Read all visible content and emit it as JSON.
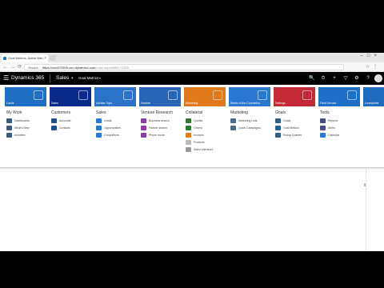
{
  "browser": {
    "tab_title": "Goal Metrics: Active Met...",
    "tab_close": "×",
    "window_controls": "–□×",
    "nav_glyphs": "←→⟳",
    "secure_label": "Secure",
    "url_host": "https://crm572905.crm.dynamics.com",
    "url_path": "/main.aspx#585172305",
    "right_icons": "☆⋮"
  },
  "navbar": {
    "waffle_glyph": "☰",
    "brand": "Dynamics 365",
    "module": "Sales",
    "module_chevron": "▾",
    "breadcrumb": "Goal Metrics",
    "breadcrumb_chevron": "▾",
    "icons": [
      "🔍",
      "⏱",
      "+",
      "▽",
      "⚙",
      "?"
    ]
  },
  "tiles": [
    {
      "label": "Lands",
      "color": "#1f6fc4"
    },
    {
      "label": "Sales",
      "color": "#0b2a8a"
    },
    {
      "label": "Adviser Tops",
      "color": "#2a73c9"
    },
    {
      "label": "Venture",
      "color": "#2866b8"
    },
    {
      "label": "Marketing",
      "color": "#e07a1a"
    },
    {
      "label": "Metric of the Counsellor",
      "color": "#2a78d2"
    },
    {
      "label": "Settings",
      "color": "#c32a36"
    },
    {
      "label": "Field Service",
      "color": "#1d6fc8"
    },
    {
      "label": "Lonelyview",
      "color": "#1f6bc0"
    }
  ],
  "menu": [
    {
      "heading": "My Work",
      "items": [
        {
          "label": "Dashboards",
          "color": "#3a5a80"
        },
        {
          "label": "What's New",
          "color": "#3a5a80"
        },
        {
          "label": "Activities",
          "color": "#3a5a80"
        }
      ]
    },
    {
      "heading": "Customers",
      "items": [
        {
          "label": "Accounts",
          "color": "#1f4e8c"
        },
        {
          "label": "Contacts",
          "color": "#1f4e8c"
        }
      ]
    },
    {
      "heading": "Sales",
      "items": [
        {
          "label": "Leads",
          "color": "#2c7ad6"
        },
        {
          "label": "Opportunities",
          "color": "#2c7ad6"
        },
        {
          "label": "Competitors",
          "color": "#2c7ad6"
        }
      ]
    },
    {
      "heading": "Venture Research",
      "items": [
        {
          "label": "Business search",
          "color": "#8e3aa6"
        },
        {
          "label": "Partner search",
          "color": "#8e3aa6"
        },
        {
          "label": "Phone mode",
          "color": "#8e3aa6"
        }
      ]
    },
    {
      "heading": "Collateral",
      "items": [
        {
          "label": "Quotes",
          "color": "#2c7a2c"
        },
        {
          "label": "Orders",
          "color": "#2c7a2c"
        },
        {
          "label": "Invoices",
          "color": "#e07a1a"
        },
        {
          "label": "Products",
          "color": "#bbbbbb"
        },
        {
          "label": "Sales Literature",
          "color": "#9a9a9a"
        }
      ]
    },
    {
      "heading": "Marketing",
      "items": [
        {
          "label": "Marketing Lists",
          "color": "#4d6a88"
        },
        {
          "label": "Quick Campaigns",
          "color": "#4d6a88"
        }
      ]
    },
    {
      "heading": "Goals",
      "items": [
        {
          "label": "Goals",
          "color": "#2f5f8f"
        },
        {
          "label": "Goal Metrics",
          "color": "#2f5f8f"
        },
        {
          "label": "Rollup Queries",
          "color": "#2f5f8f"
        }
      ]
    },
    {
      "heading": "Tools",
      "items": [
        {
          "label": "Reports",
          "color": "#4a4a8a"
        },
        {
          "label": "Alerts",
          "color": "#4a4a8a"
        },
        {
          "label": "Calendar",
          "color": "#2c7ad6"
        }
      ]
    }
  ]
}
